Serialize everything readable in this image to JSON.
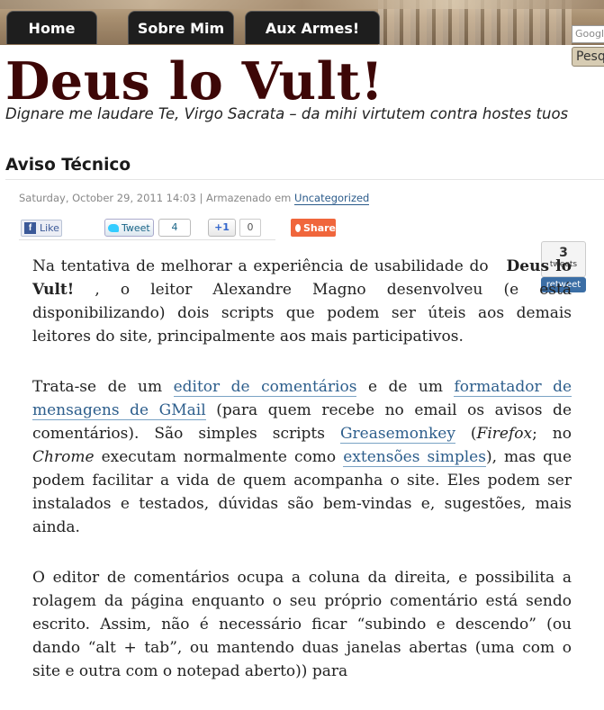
{
  "nav": {
    "home": "Home",
    "sobre": "Sobre Mim",
    "aux": "Aux Armes!"
  },
  "search": {
    "placeholder": "Google",
    "button": "Pesq"
  },
  "site": {
    "title": "Deus lo Vult!",
    "tagline": "Dignare me laudare Te, Virgo Sacrata – da mihi virtutem contra hostes tuos"
  },
  "post": {
    "title": "Aviso Técnico",
    "date": "Saturday, October 29, 2011 14:03",
    "stored_in": " | Armazenado em ",
    "category": "Uncategorized"
  },
  "share": {
    "like": "Like",
    "tweet": "Tweet",
    "tweet_count": "4",
    "plusone": "+1",
    "plusone_count": "0",
    "share": "Share"
  },
  "tweetmeme": {
    "count": "3",
    "label": "tweets",
    "retweet": "retweet"
  },
  "content": {
    "p1_a": "Na tentativa de melhorar a experiência de usabilidade do ",
    "p1_bold": "Deus lo Vult!",
    "p1_b": " , o leitor Alexandre Magno desenvolveu (e está disponibilizando) dois scripts que podem ser úteis aos demais leitores do site, principalmente aos mais participativos.",
    "p2_a": "Trata-se de um ",
    "p2_link1": "editor de comentários",
    "p2_b": " e de um ",
    "p2_link2": "formatador de mensagens de GMail",
    "p2_c": " (para quem recebe no email os avisos de comentários). São simples scripts ",
    "p2_link3": "Greasemonkey",
    "p2_d": " (",
    "p2_firefox": "Firefox",
    "p2_e": "; no ",
    "p2_chrome": "Chrome",
    "p2_f": " executam normalmente como ",
    "p2_link4": "extensões simples",
    "p2_g": "), mas que podem facilitar a vida de quem acompanha o site. Eles podem ser instalados e testados, dúvidas são bem-vindas e, sugestões, mais ainda.",
    "p3": "O editor de comentários ocupa a coluna da direita, e possibilita a rolagem da página enquanto o seu próprio comentário está sendo escrito. Assim, não é necessário ficar “subindo e descendo” (ou dando “alt + tab”, ou mantendo duas janelas abertas (uma com o site e outra com o notepad aberto)) para"
  }
}
